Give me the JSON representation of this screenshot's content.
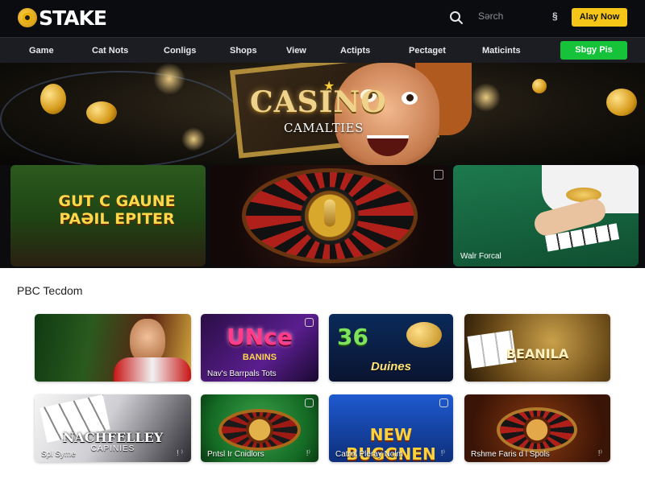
{
  "header": {
    "logo_text": "STAKE",
    "search_placeholder": "Sərch",
    "lang_label": "§",
    "play_button": "Alay Now"
  },
  "nav": {
    "items": [
      "Game",
      "Cat Nots",
      "Conligs",
      "Shops",
      "View",
      "Actipts",
      "Pectaget",
      "Maticints"
    ],
    "cta": "Sbgy Pis"
  },
  "hero": {
    "title": "CASINO",
    "subtitle": "CAMALTIES"
  },
  "featured": {
    "cards": [
      {
        "text_line1": "GUT C GAUNE",
        "text_line2": "PAƏIL EPITER"
      },
      {
        "caption": ""
      },
      {
        "caption": "Walr Forcal"
      }
    ]
  },
  "section": {
    "title": "PBC Tecdom"
  },
  "games": [
    {
      "title": "",
      "caption": ""
    },
    {
      "title": "UNce",
      "sub": "BANINS",
      "caption": "Nav's Barrpals Tots"
    },
    {
      "title": "36",
      "sub": "Duines",
      "caption": ""
    },
    {
      "title": "BEANILA",
      "caption": ""
    },
    {
      "title": "NACHFELLEY",
      "sub": "CAPINIES",
      "caption": "Spl Syme",
      "dots": "! ⁾"
    },
    {
      "title": "",
      "caption": "Pntsl Ir Cnidlors",
      "dots": "!⁾"
    },
    {
      "title": "NEW BUGGNEN",
      "caption": "Catrol Pleray Nolm",
      "dots": "!⁾"
    },
    {
      "title": "",
      "caption": "Rshme Faris d l Spols",
      "dots": "!⁾"
    }
  ],
  "colors": {
    "accent_yellow": "#f5c518",
    "accent_green": "#16c23a",
    "header_bg": "#0b0c10",
    "nav_bg": "#1b1d22"
  },
  "icons": [
    "search-icon",
    "logo-icon",
    "language-icon",
    "card-info-icon"
  ]
}
